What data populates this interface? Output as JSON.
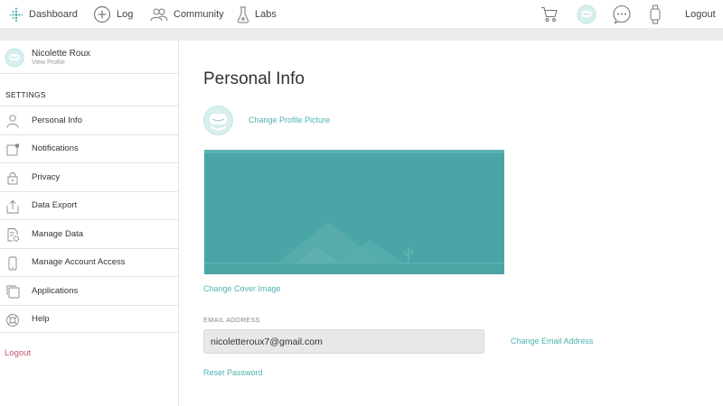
{
  "nav": {
    "dashboard": "Dashboard",
    "log": "Log",
    "community": "Community",
    "labs": "Labs",
    "logout": "Logout",
    "icons": [
      "fitbit-logo-icon",
      "plus-circle-icon",
      "people-icon",
      "flask-icon",
      "cart-icon",
      "avatar-icon",
      "chat-bubble-icon",
      "watch-icon"
    ]
  },
  "profile": {
    "name": "Nicolette Roux",
    "view_profile": "View Profile"
  },
  "sidebar": {
    "title": "SETTINGS",
    "items": [
      {
        "label": "Personal Info",
        "icon": "person-icon"
      },
      {
        "label": "Notifications",
        "icon": "notification-icon"
      },
      {
        "label": "Privacy",
        "icon": "lock-icon"
      },
      {
        "label": "Data Export",
        "icon": "export-icon"
      },
      {
        "label": "Manage Data",
        "icon": "manage-data-icon"
      },
      {
        "label": "Manage Account Access",
        "icon": "phone-icon"
      },
      {
        "label": "Applications",
        "icon": "applications-icon"
      },
      {
        "label": "Help",
        "icon": "help-icon"
      }
    ],
    "logout": "Logout"
  },
  "main": {
    "title": "Personal Info",
    "change_picture": "Change Profile Picture",
    "change_cover": "Change Cover Image",
    "email_label": "EMAIL ADDRESS",
    "email_value": "nicoletteroux7@gmail.com",
    "change_email": "Change Email Address",
    "reset_password": "Reset Password"
  },
  "colors": {
    "accent": "#4fb3b0",
    "logout_red": "#c1556b",
    "cover_teal": "#4aa6a6"
  }
}
